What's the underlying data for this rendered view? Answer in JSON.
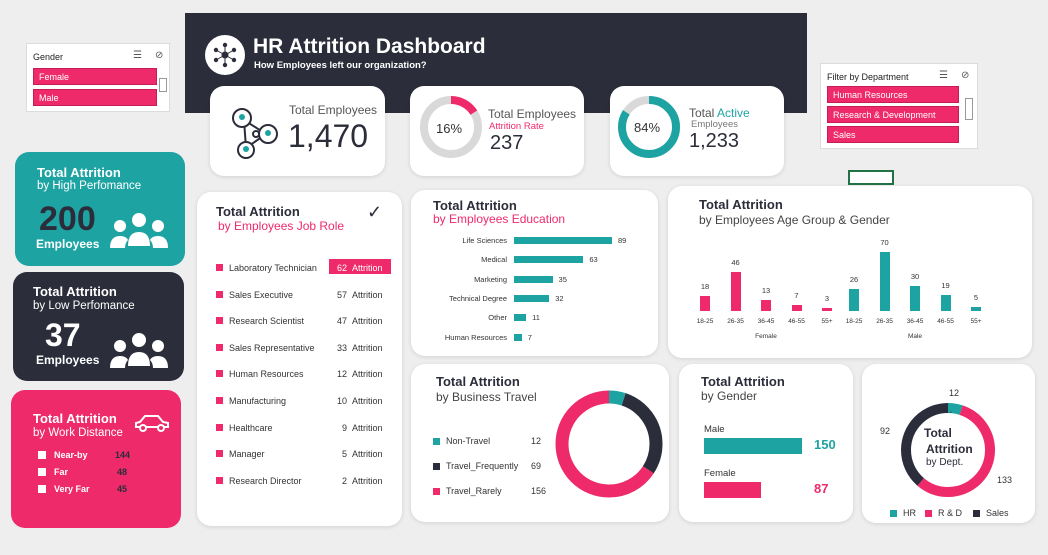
{
  "gender_slicer": {
    "header": "Gender",
    "options": [
      "Female",
      "Male"
    ]
  },
  "dept_slicer": {
    "header": "Filter by Department",
    "options": [
      "Human Resources",
      "Research & Development",
      "Sales"
    ]
  },
  "header": {
    "title": "HR Attrition Dashboard",
    "subtitle": "How Employees left our organization?"
  },
  "kpi_total": {
    "label": "Total Employees",
    "value": "1,470"
  },
  "kpi_attrition": {
    "label": "Total Employees",
    "sublabel": "Attrition Rate",
    "percent": "16%",
    "percent_value": 16,
    "value": "237"
  },
  "kpi_active": {
    "label_a": "Total",
    "label_b": "Active",
    "sublabel": "Employees",
    "percent": "84%",
    "percent_value": 84,
    "value": "1,233"
  },
  "high_perf": {
    "title": "Total Attrition",
    "subtitle": "by High Perfomance",
    "value": "200",
    "unit": "Employees"
  },
  "low_perf": {
    "title": "Total Attrition",
    "subtitle": "by Low Perfomance",
    "value": "37",
    "unit": "Employees"
  },
  "work_distance": {
    "title": "Total Attrition",
    "subtitle": "by Work Distance",
    "rows": [
      {
        "label": "Near-by",
        "value": "144"
      },
      {
        "label": "Far",
        "value": "48"
      },
      {
        "label": "Very Far",
        "value": "45"
      }
    ]
  },
  "job_role": {
    "title": "Total Attrition",
    "subtitle": "by Employees Job Role",
    "unit": "Attrition",
    "rows": [
      {
        "label": "Laboratory Technician",
        "value": "62"
      },
      {
        "label": "Sales Executive",
        "value": "57"
      },
      {
        "label": "Research Scientist",
        "value": "47"
      },
      {
        "label": "Sales Representative",
        "value": "33"
      },
      {
        "label": "Human Resources",
        "value": "12"
      },
      {
        "label": "Manufacturing",
        "value": "10"
      },
      {
        "label": "Healthcare",
        "value": "9"
      },
      {
        "label": "Manager",
        "value": "5"
      },
      {
        "label": "Research Director",
        "value": "2"
      }
    ]
  },
  "education": {
    "title": "Total Attrition",
    "subtitle": "by Employees Education"
  },
  "age_gender": {
    "title": "Total Attrition",
    "subtitle": "by Employees Age Group & Gender"
  },
  "travel": {
    "title": "Total Attrition",
    "subtitle": "by Business Travel"
  },
  "gender_chart": {
    "title": "Total Attrition",
    "subtitle": "by Gender"
  },
  "dept_chart": {
    "center_a": "Total",
    "center_b": "Attrition",
    "center_c": "by Dept."
  },
  "colors": {
    "pink": "#ee2a6b",
    "teal": "#1ea3a3",
    "dark": "#2b2d3a"
  },
  "chart_data": [
    {
      "type": "bar",
      "categories": [
        "Life Sciences",
        "Medical",
        "Marketing",
        "Technical Degree",
        "Other",
        "Human Resources"
      ],
      "values": [
        89,
        63,
        35,
        32,
        11,
        7
      ]
    },
    {
      "type": "bar",
      "categories": [
        "18-25",
        "26-35",
        "36-45",
        "46-55",
        "55+"
      ],
      "groups": [
        "Female",
        "Male"
      ],
      "series": [
        {
          "values": [
            18,
            46,
            13,
            7,
            3
          ]
        },
        {
          "values": [
            26,
            70,
            30,
            19,
            5
          ]
        }
      ]
    },
    {
      "type": "pie",
      "categories": [
        "Non-Travel",
        "Travel_Frequently",
        "Travel_Rarely"
      ],
      "values": [
        12,
        69,
        156
      ]
    },
    {
      "type": "bar",
      "categories": [
        "Male",
        "Female"
      ],
      "values": [
        150,
        87
      ]
    },
    {
      "type": "pie",
      "categories": [
        "HR",
        "R & D",
        "Sales"
      ],
      "values": [
        12,
        133,
        92
      ]
    }
  ]
}
